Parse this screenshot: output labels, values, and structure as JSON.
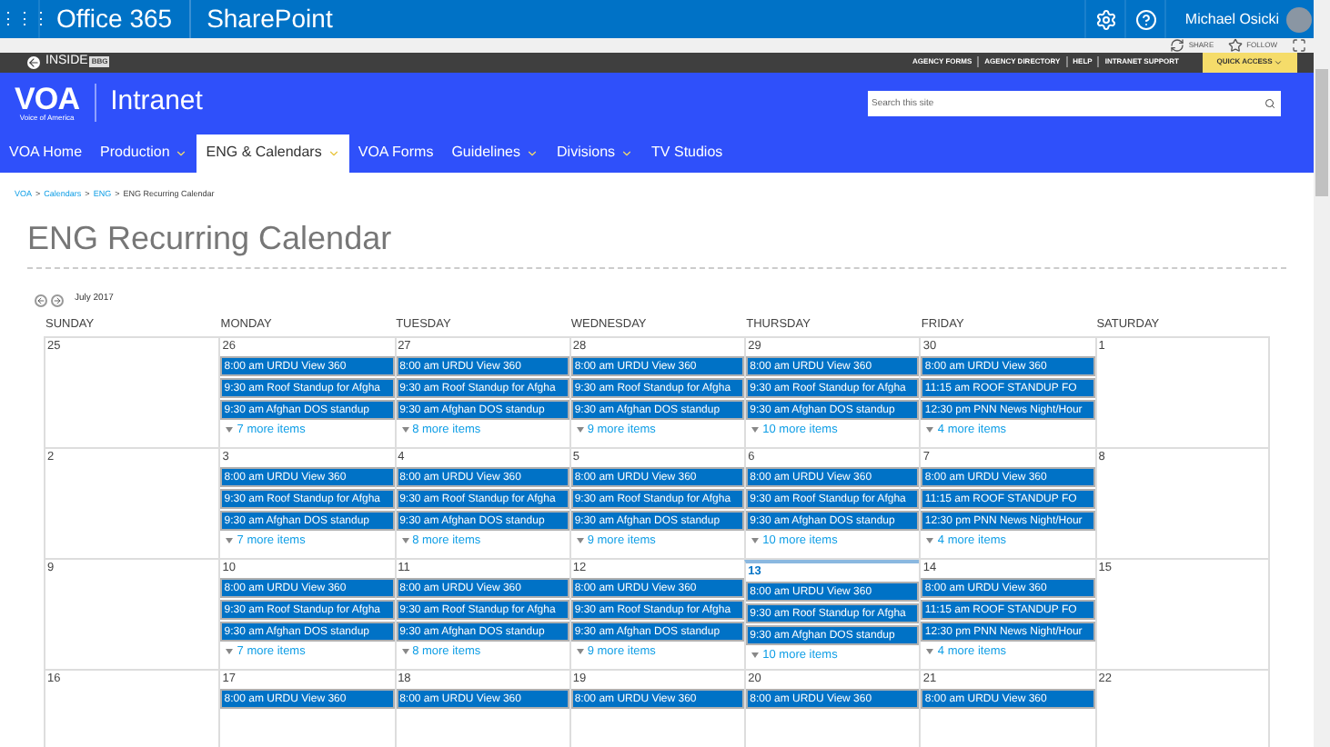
{
  "suite_bar": {
    "app_launcher": "⋮⋮⋮",
    "brand": "Office 365",
    "app": "SharePoint",
    "user": "Michael Osicki"
  },
  "actions": [
    {
      "label": "SHARE",
      "kind": "share"
    },
    {
      "label": "FOLLOW",
      "kind": "follow"
    }
  ],
  "agency_bar": {
    "logo": "INSIDE",
    "logo_badge": "BBG",
    "links": [
      "AGENCY FORMS",
      "AGENCY DIRECTORY",
      "HELP",
      "INTRANET SUPPORT"
    ],
    "quick_access": "QUICK ACCESS"
  },
  "site_header": {
    "logo": "VOA",
    "logo_caption": "Voice of America",
    "title": "Intranet",
    "search": {
      "placeholder": "Search this site"
    }
  },
  "nav": [
    {
      "label": "VOA Home",
      "dropdown": false,
      "selected": false
    },
    {
      "label": "Production",
      "dropdown": true,
      "selected": false
    },
    {
      "label": "ENG & Calendars",
      "dropdown": true,
      "selected": true
    },
    {
      "label": "VOA Forms",
      "dropdown": false,
      "selected": false
    },
    {
      "label": "Guidelines",
      "dropdown": true,
      "selected": false
    },
    {
      "label": "Divisions",
      "dropdown": true,
      "selected": false
    },
    {
      "label": "TV Studios",
      "dropdown": false,
      "selected": false
    }
  ],
  "breadcrumb_separator": ">",
  "breadcrumb": [
    {
      "label": "VOA",
      "link": true
    },
    {
      "label": "Calendars",
      "link": true
    },
    {
      "label": "ENG",
      "link": true
    },
    {
      "label": "ENG Recurring Calendar",
      "link": false
    }
  ],
  "page_title": "ENG Recurring Calendar",
  "calendar": {
    "month": "July 2017",
    "weekdays": [
      "SUNDAY",
      "MONDAY",
      "TUESDAY",
      "WEDNESDAY",
      "THURSDAY",
      "FRIDAY",
      "SATURDAY"
    ],
    "weeks": [
      {
        "days": [
          {
            "date": "25",
            "today": false
          },
          {
            "date": "26",
            "today": false,
            "events": [
              "8:00 am URDU View 360",
              "9:30 am Roof Standup for Afgha",
              "9:30 am Afghan DOS standup"
            ],
            "more": "7 more items"
          },
          {
            "date": "27",
            "today": false,
            "events": [
              "8:00 am URDU View 360",
              "9:30 am Roof Standup for Afgha",
              "9:30 am Afghan DOS standup"
            ],
            "more": "8 more items"
          },
          {
            "date": "28",
            "today": false,
            "events": [
              "8:00 am URDU View 360",
              "9:30 am Roof Standup for Afgha",
              "9:30 am Afghan DOS standup"
            ],
            "more": "9 more items"
          },
          {
            "date": "29",
            "today": false,
            "events": [
              "8:00 am URDU View 360",
              "9:30 am Roof Standup for Afgha",
              "9:30 am Afghan DOS standup"
            ],
            "more": "10 more items"
          },
          {
            "date": "30",
            "today": false,
            "events": [
              "8:00 am URDU View 360",
              "11:15 am ROOF STANDUP FO",
              "12:30 pm PNN News Night/Hour"
            ],
            "more": "4 more items"
          },
          {
            "date": "1",
            "today": false
          }
        ]
      },
      {
        "days": [
          {
            "date": "2",
            "today": false
          },
          {
            "date": "3",
            "today": false,
            "events": [
              "8:00 am URDU View 360",
              "9:30 am Roof Standup for Afgha",
              "9:30 am Afghan DOS standup"
            ],
            "more": "7 more items"
          },
          {
            "date": "4",
            "today": false,
            "events": [
              "8:00 am URDU View 360",
              "9:30 am Roof Standup for Afgha",
              "9:30 am Afghan DOS standup"
            ],
            "more": "8 more items"
          },
          {
            "date": "5",
            "today": false,
            "events": [
              "8:00 am URDU View 360",
              "9:30 am Roof Standup for Afgha",
              "9:30 am Afghan DOS standup"
            ],
            "more": "9 more items"
          },
          {
            "date": "6",
            "today": false,
            "events": [
              "8:00 am URDU View 360",
              "9:30 am Roof Standup for Afgha",
              "9:30 am Afghan DOS standup"
            ],
            "more": "10 more items"
          },
          {
            "date": "7",
            "today": false,
            "events": [
              "8:00 am URDU View 360",
              "11:15 am ROOF STANDUP FO",
              "12:30 pm PNN News Night/Hour"
            ],
            "more": "4 more items"
          },
          {
            "date": "8",
            "today": false
          }
        ]
      },
      {
        "days": [
          {
            "date": "9",
            "today": false
          },
          {
            "date": "10",
            "today": false,
            "events": [
              "8:00 am URDU View 360",
              "9:30 am Roof Standup for Afgha",
              "9:30 am Afghan DOS standup"
            ],
            "more": "7 more items"
          },
          {
            "date": "11",
            "today": false,
            "events": [
              "8:00 am URDU View 360",
              "9:30 am Roof Standup for Afgha",
              "9:30 am Afghan DOS standup"
            ],
            "more": "8 more items"
          },
          {
            "date": "12",
            "today": false,
            "events": [
              "8:00 am URDU View 360",
              "9:30 am Roof Standup for Afgha",
              "9:30 am Afghan DOS standup"
            ],
            "more": "9 more items"
          },
          {
            "date": "13",
            "today": true,
            "events": [
              "8:00 am URDU View 360",
              "9:30 am Roof Standup for Afgha",
              "9:30 am Afghan DOS standup"
            ],
            "more": "10 more items"
          },
          {
            "date": "14",
            "today": false,
            "events": [
              "8:00 am URDU View 360",
              "11:15 am ROOF STANDUP FO",
              "12:30 pm PNN News Night/Hour"
            ],
            "more": "4 more items"
          },
          {
            "date": "15",
            "today": false
          }
        ]
      },
      {
        "days": [
          {
            "date": "16",
            "today": false
          },
          {
            "date": "17",
            "today": false,
            "events": [
              "8:00 am URDU View 360"
            ]
          },
          {
            "date": "18",
            "today": false,
            "events": [
              "8:00 am URDU View 360"
            ]
          },
          {
            "date": "19",
            "today": false,
            "events": [
              "8:00 am URDU View 360"
            ]
          },
          {
            "date": "20",
            "today": false,
            "events": [
              "8:00 am URDU View 360"
            ]
          },
          {
            "date": "21",
            "today": false,
            "events": [
              "8:00 am URDU View 360"
            ]
          },
          {
            "date": "22",
            "today": false
          }
        ]
      }
    ]
  }
}
